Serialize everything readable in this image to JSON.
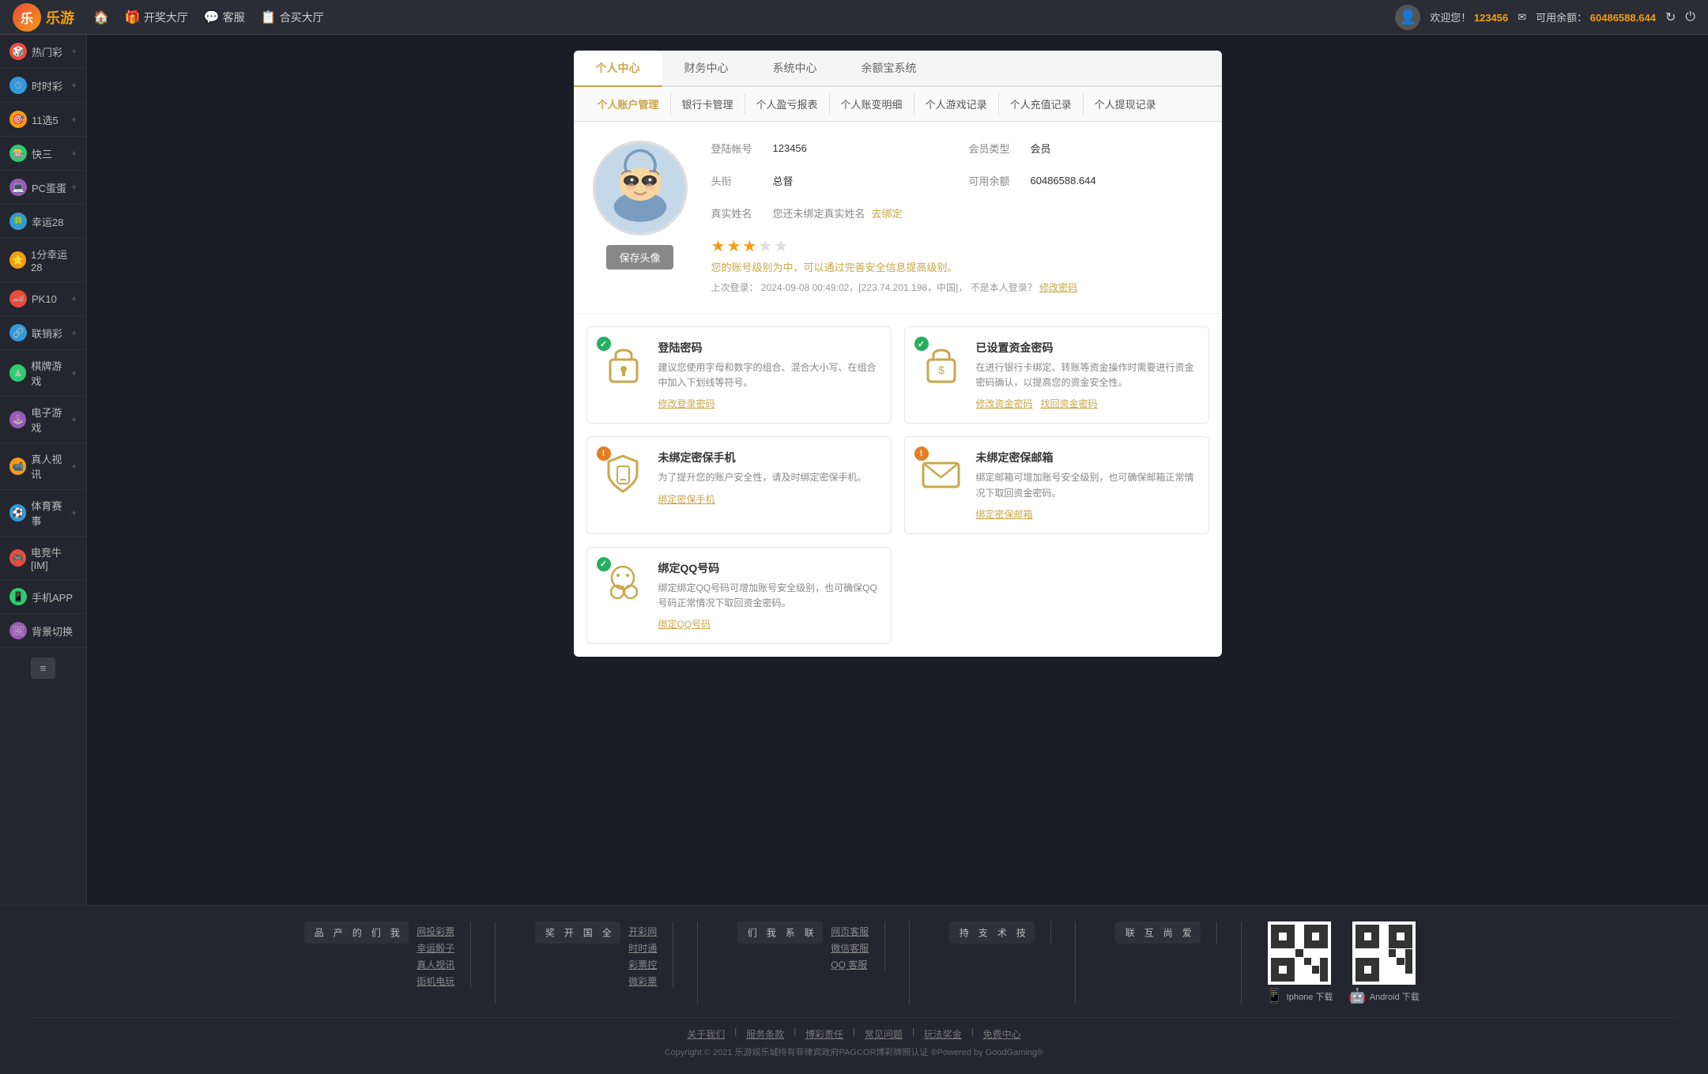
{
  "logo": {
    "text": "乐游",
    "symbol": "乐"
  },
  "nav": {
    "home_icon": "🏠",
    "lottery_label": "开奖大厅",
    "lottery_icon": "🎁",
    "service_label": "客服",
    "service_icon": "💬",
    "hall_label": "合买大厅",
    "hall_icon": "📋",
    "welcome_prefix": "欢迎您！",
    "username": "123456",
    "balance_prefix": "可用余额：",
    "balance": "60486588.644",
    "refresh_icon": "↻",
    "power_icon": "⏻"
  },
  "sidebar": {
    "items": [
      {
        "label": "热门彩",
        "icon": "🎲",
        "color": "red"
      },
      {
        "label": "时时彩",
        "icon": "⏱",
        "color": "blue"
      },
      {
        "label": "11选5",
        "icon": "🎯",
        "color": "orange"
      },
      {
        "label": "快三",
        "icon": "🎰",
        "color": "green"
      },
      {
        "label": "PC蛋蛋",
        "icon": "💻",
        "color": "purple"
      },
      {
        "label": "幸运28",
        "icon": "🍀",
        "color": "blue"
      },
      {
        "label": "1分幸运28",
        "icon": "⭐",
        "color": "orange"
      },
      {
        "label": "PK10",
        "icon": "🏎",
        "color": "red"
      },
      {
        "label": "联销彩",
        "icon": "🔗",
        "color": "blue"
      },
      {
        "label": "棋牌游戏",
        "icon": "♟",
        "color": "green"
      },
      {
        "label": "电子游戏",
        "icon": "🕹",
        "color": "purple"
      },
      {
        "label": "真人视讯",
        "icon": "📹",
        "color": "orange"
      },
      {
        "label": "体育赛事",
        "icon": "⚽",
        "color": "blue"
      },
      {
        "label": "电竞牛[IM]",
        "icon": "🎮",
        "color": "red"
      },
      {
        "label": "手机APP",
        "icon": "📱",
        "color": "green"
      },
      {
        "label": "背景切换",
        "icon": "🖼",
        "color": "purple"
      }
    ]
  },
  "tabs": {
    "main": [
      {
        "label": "个人中心",
        "active": true
      },
      {
        "label": "财务中心",
        "active": false
      },
      {
        "label": "系统中心",
        "active": false
      },
      {
        "label": "余额宝系统",
        "active": false
      }
    ],
    "sub": [
      {
        "label": "个人账户管理",
        "active": true
      },
      {
        "label": "银行卡管理",
        "active": false
      },
      {
        "label": "个人盈亏报表",
        "active": false
      },
      {
        "label": "个人账变明细",
        "active": false
      },
      {
        "label": "个人游戏记录",
        "active": false
      },
      {
        "label": "个人充值记录",
        "active": false
      },
      {
        "label": "个人提现记录",
        "active": false
      }
    ]
  },
  "profile": {
    "login_account_label": "登陆帐号",
    "login_account": "123456",
    "member_type_label": "会员类型",
    "member_type": "会员",
    "level_label": "头衔",
    "level": "总督",
    "available_balance_label": "可用余额",
    "available_balance": "60486588.644",
    "real_name_label": "真实姓名",
    "real_name_notice": "您还未绑定真实姓名",
    "real_name_link": "去绑定",
    "save_avatar_btn": "保存头像",
    "stars_filled": 3,
    "stars_empty": 2,
    "level_notice": "您的账号级别为中，可以通过完善安全信息提高级别。",
    "last_login_prefix": "上次登录：",
    "last_login": "2024-09-08 00:49:02，[223.74.201.198，中国]",
    "not_me_text": "不是本人登录？",
    "change_pwd_link": "修改密码"
  },
  "security": {
    "cards": [
      {
        "status": "ok",
        "status_symbol": "✓",
        "title": "登陆密码",
        "desc": "建议您使用字母和数字的组合、混合大小写、在组合中加入下划线等符号。",
        "links": [
          {
            "label": "修改登录密码"
          }
        ]
      },
      {
        "status": "ok",
        "status_symbol": "✓",
        "title": "已设置资金密码",
        "desc": "在进行银行卡绑定、转账等资金操作时需要进行资金密码确认，以提高您的资金安全性。",
        "links": [
          {
            "label": "修改资金密码"
          },
          {
            "label": "找回资金密码"
          }
        ]
      },
      {
        "status": "warn",
        "status_symbol": "!",
        "title": "未绑定密保手机",
        "desc": "为了提升您的账户安全性，请及时绑定密保手机。",
        "links": [
          {
            "label": "绑定密保手机"
          }
        ]
      },
      {
        "status": "warn",
        "status_symbol": "!",
        "title": "未绑定密保邮箱",
        "desc": "绑定邮箱可增加账号安全级别，也可确保邮箱正常情况下取回资金密码。",
        "links": [
          {
            "label": "绑定密保邮箱"
          }
        ]
      },
      {
        "status": "ok",
        "status_symbol": "✓",
        "title": "绑定QQ号码",
        "desc": "绑定绑定QQ号码可增加账号安全级别，也可确保QQ号码正常情况下取回资金密码。",
        "links": [
          {
            "label": "绑定QQ号码"
          }
        ]
      }
    ]
  },
  "footer": {
    "sections": [
      {
        "vertical_label": "我们的产品",
        "links": [
          "网投彩票",
          "幸运骰子",
          "真人视讯",
          "街机电玩"
        ]
      },
      {
        "vertical_label": "全国开奖",
        "links": [
          "开彩网",
          "时时通",
          "彩票控",
          "微彩票"
        ]
      },
      {
        "vertical_label": "联系我们",
        "links": [
          "网页客服",
          "微信客服",
          "QQ 客服"
        ]
      },
      {
        "vertical_label": "技术支持",
        "links": []
      },
      {
        "vertical_label": "爱尚互联",
        "links": []
      }
    ],
    "qr": {
      "ios_label": "Iphone 下载",
      "android_label": "Android 下载"
    },
    "bottom_links": [
      "关于我们",
      "服务条款",
      "博彩责任",
      "常见问题",
      "玩法奖金",
      "免费中心"
    ],
    "copyright": "Copyright © 2021 乐游娱乐城持有菲律宾政府PAGCOR博彩牌照认证 ®Powered by GoodGaming®"
  },
  "sidebar_toggle": "≡"
}
